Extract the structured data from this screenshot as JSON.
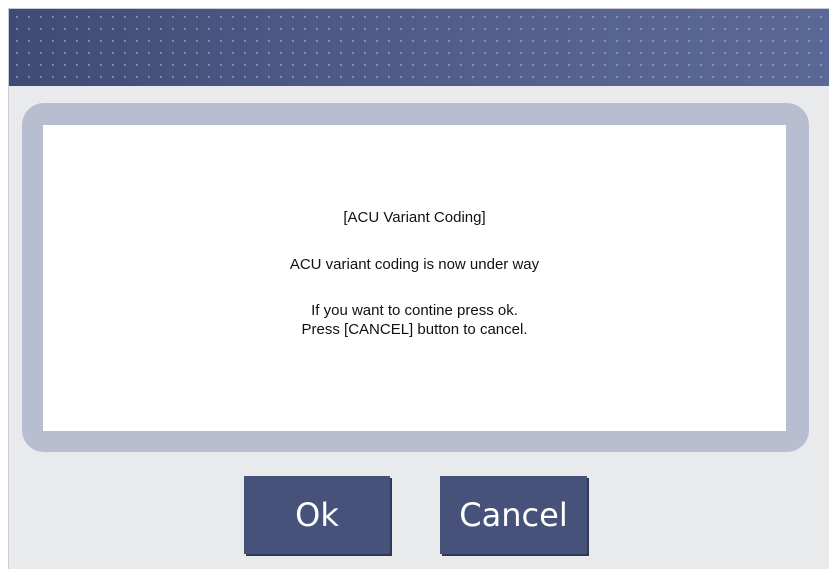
{
  "dialog": {
    "title": "",
    "message": {
      "heading": "[ACU Variant Coding]",
      "status": "ACU variant coding is now under way",
      "instruction_line1": "If you want to contine press ok.",
      "instruction_line2": "Press [CANCEL] button to cancel."
    },
    "buttons": {
      "ok_label": "Ok",
      "cancel_label": "Cancel"
    }
  },
  "colors": {
    "titlebar": "#4a5680",
    "frame": "#b8bdcf",
    "button": "#47527a",
    "background": "#e9eaec"
  }
}
